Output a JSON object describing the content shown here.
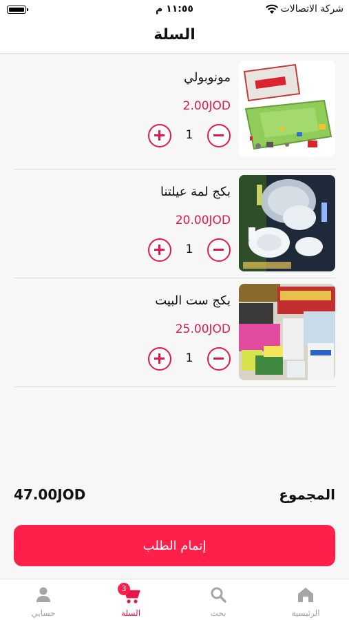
{
  "status_bar": {
    "time": "١١:٥٥ م",
    "carrier": "شركة الاتصالات"
  },
  "header": {
    "title": "السلة"
  },
  "cart": {
    "items": [
      {
        "name": "مونوبولي",
        "price": "2.00JOD",
        "quantity": "1",
        "image": "monopoly-board-game"
      },
      {
        "name": "بكج لمة عيلتنا",
        "price": "20.00JOD",
        "quantity": "1",
        "image": "plastic-plates-cups"
      },
      {
        "name": "بكج ست البيت",
        "price": "25.00JOD",
        "quantity": "1",
        "image": "kitchen-supplies"
      }
    ]
  },
  "summary": {
    "total_label": "المجموع",
    "total_value": "47.00JOD",
    "checkout_label": "إتمام الطلب"
  },
  "tab_bar": {
    "tabs": [
      {
        "label": "الرئيسية",
        "icon": "home-icon"
      },
      {
        "label": "بحث",
        "icon": "search-icon"
      },
      {
        "label": "السلة",
        "icon": "cart-icon",
        "badge": "3",
        "active": true
      },
      {
        "label": "حسابي",
        "icon": "person-icon"
      }
    ]
  },
  "colors": {
    "accent": "#ff1f4b",
    "price": "#e5174a",
    "inactive_tab": "#a5a5a5"
  }
}
